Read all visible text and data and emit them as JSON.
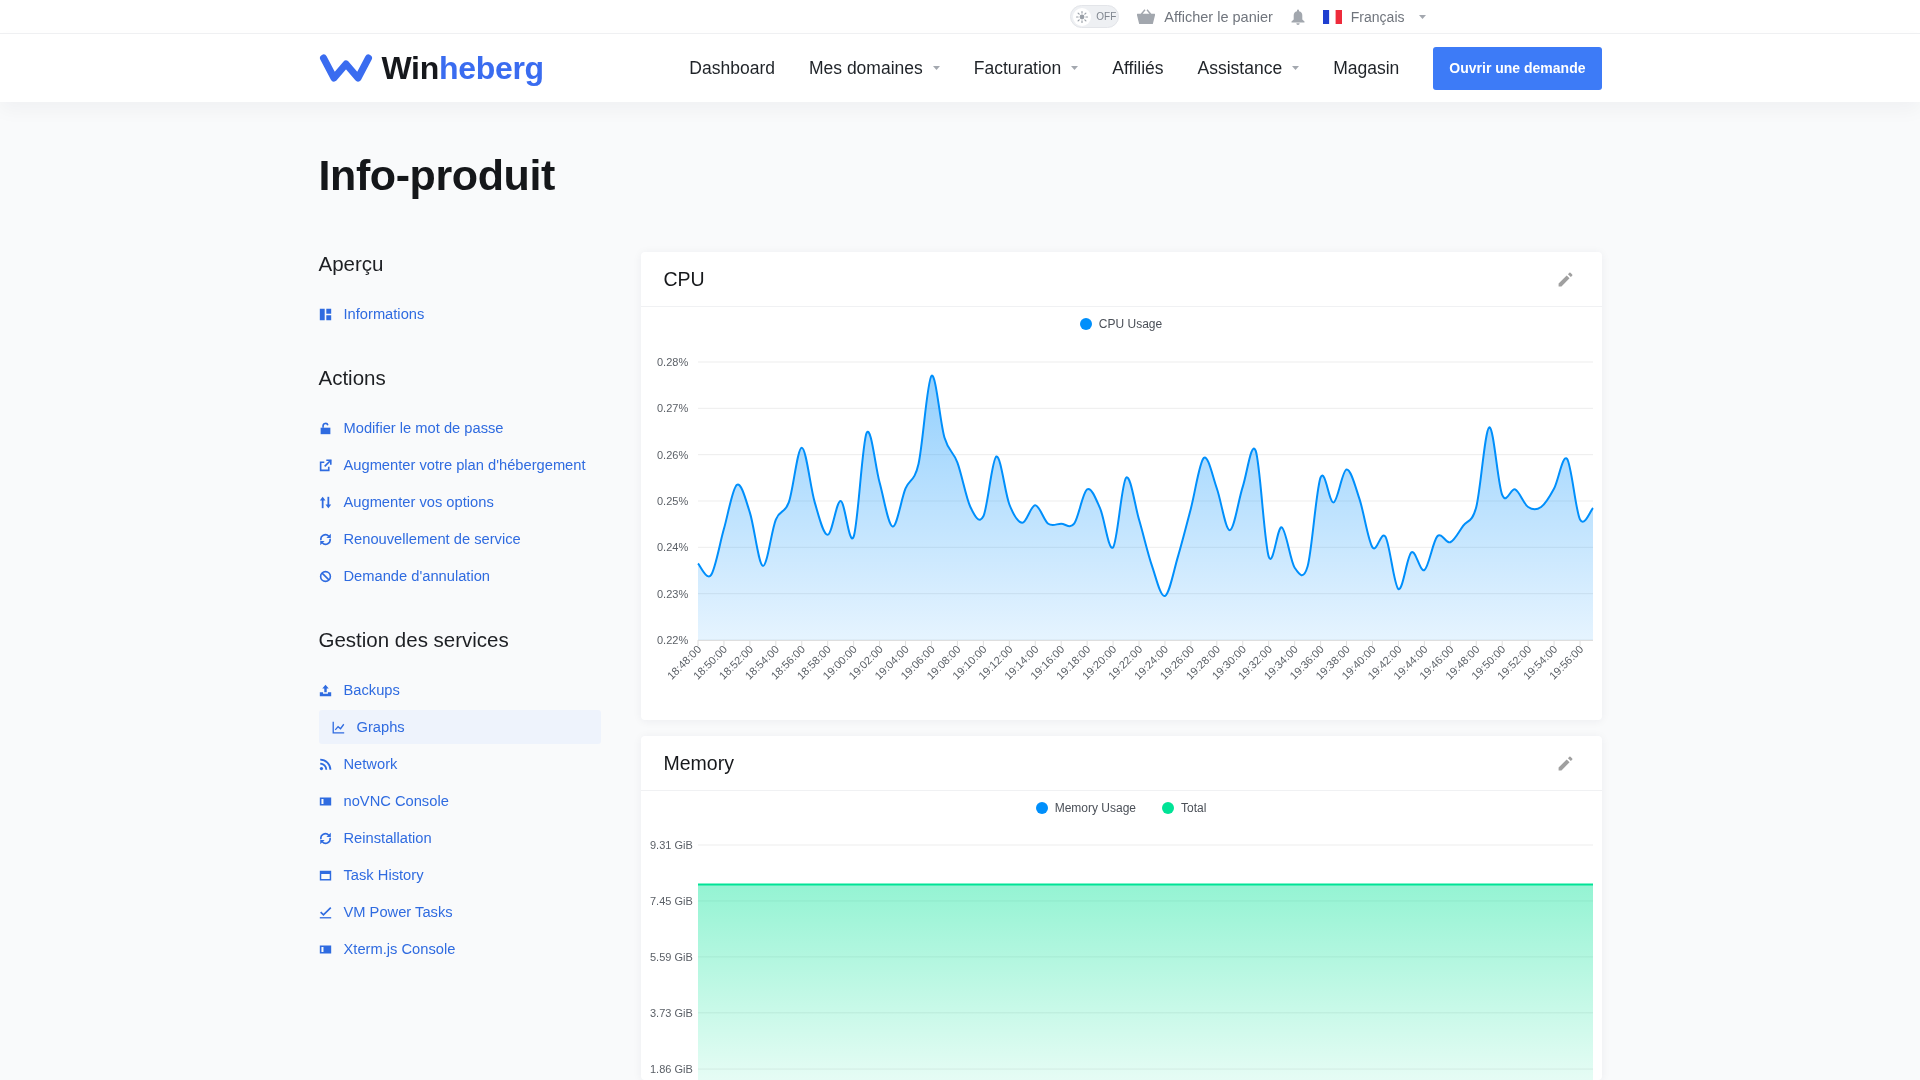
{
  "topbar": {
    "theme_toggle": {
      "label": "OFF",
      "on": false
    },
    "cart_link": "Afficher le panier",
    "language": "Français"
  },
  "navbar": {
    "brand": [
      "Win",
      "heberg"
    ],
    "links": [
      {
        "label": "Dashboard",
        "dropdown": false
      },
      {
        "label": "Mes domaines",
        "dropdown": true
      },
      {
        "label": "Facturation",
        "dropdown": true
      },
      {
        "label": "Affiliés",
        "dropdown": false
      },
      {
        "label": "Assistance",
        "dropdown": true
      },
      {
        "label": "Magasin",
        "dropdown": false
      }
    ],
    "cta": "Ouvrir une demande"
  },
  "page_title": "Info-produit",
  "sidebar": {
    "sections": [
      {
        "title": "Aperçu",
        "items": [
          {
            "label": "Informations",
            "selected": false
          }
        ]
      },
      {
        "title": "Actions",
        "items": [
          {
            "label": "Modifier le mot de passe",
            "selected": false
          },
          {
            "label": "Augmenter votre plan d'hébergement",
            "selected": false
          },
          {
            "label": "Augmenter vos options",
            "selected": false
          },
          {
            "label": "Renouvellement de service",
            "selected": false
          },
          {
            "label": "Demande d'annulation",
            "selected": false
          }
        ]
      },
      {
        "title": "Gestion des services",
        "items": [
          {
            "label": "Backups",
            "selected": false
          },
          {
            "label": "Graphs",
            "selected": true
          },
          {
            "label": "Network",
            "selected": false
          },
          {
            "label": "noVNC Console",
            "selected": false
          },
          {
            "label": "Reinstallation",
            "selected": false
          },
          {
            "label": "Task History",
            "selected": false
          },
          {
            "label": "VM Power Tasks",
            "selected": false
          },
          {
            "label": "Xterm.js Console",
            "selected": false
          }
        ]
      }
    ]
  },
  "cards": [
    {
      "title": "CPU",
      "chart_data": {
        "type": "area",
        "grid": true,
        "categories": [
          "18:48:00",
          null,
          "18:50:00",
          null,
          "18:52:00",
          null,
          "18:54:00",
          null,
          "18:56:00",
          null,
          "18:58:00",
          null,
          "19:00:00",
          null,
          "19:02:00",
          null,
          "19:04:00",
          null,
          "19:06:00",
          null,
          "19:08:00",
          null,
          "19:10:00",
          null,
          "19:12:00",
          null,
          "19:14:00",
          null,
          "19:16:00",
          null,
          "19:18:00",
          null,
          "19:20:00",
          null,
          "19:22:00",
          null,
          "19:24:00",
          null,
          "19:26:00",
          null,
          "19:28:00",
          null,
          "19:30:00",
          null,
          "19:32:00",
          null,
          "19:34:00",
          null,
          "19:36:00",
          null,
          "19:38:00",
          null,
          "19:40:00",
          null,
          "19:42:00",
          null,
          "19:44:00",
          null,
          "19:46:00",
          null,
          "19:48:00",
          null,
          "19:50:00",
          null,
          "19:52:00",
          null,
          "19:54:00",
          null,
          "19:56:00",
          null
        ],
        "ylim": [
          0.22,
          0.28
        ],
        "yticks": [
          {
            "value": 0.28,
            "label": "0.28%"
          },
          {
            "value": 0.27,
            "label": "0.27%"
          },
          {
            "value": 0.26,
            "label": "0.26%"
          },
          {
            "value": 0.25,
            "label": "0.25%"
          },
          {
            "value": 0.24,
            "label": "0.24%"
          },
          {
            "value": 0.23,
            "label": "0.23%"
          },
          {
            "value": 0.22,
            "label": "0.22%"
          }
        ],
        "series": [
          {
            "name": "CPU Usage",
            "color": "#008ffb",
            "values": [
              0.2365,
              0.234,
              0.244,
              0.2535,
              0.2475,
              0.236,
              0.246,
              0.2497,
              0.2615,
              0.2497,
              0.2427,
              0.25,
              0.2423,
              0.2647,
              0.254,
              0.2445,
              0.2527,
              0.258,
              0.277,
              0.2637,
              0.2583,
              0.2487,
              0.2467,
              0.2596,
              0.2493,
              0.2453,
              0.2491,
              0.2451,
              0.2451,
              0.2451,
              0.2525,
              0.2484,
              0.24,
              0.255,
              0.246,
              0.236,
              0.2295,
              0.238,
              0.2484,
              0.2593,
              0.2527,
              0.2437,
              0.2531,
              0.2608,
              0.238,
              0.2443,
              0.2356,
              0.2359,
              0.2551,
              0.2497,
              0.2568,
              0.2504,
              0.24,
              0.2423,
              0.231,
              0.2389,
              0.2351,
              0.2424,
              0.2411,
              0.2447,
              0.2487,
              0.2659,
              0.2513,
              0.2525,
              0.2487,
              0.2487,
              0.2527,
              0.2591,
              0.246,
              0.2485
            ]
          }
        ]
      }
    },
    {
      "title": "Memory",
      "chart_data": {
        "type": "area",
        "grid": true,
        "ylim": [
          0,
          9.31
        ],
        "yticks": [
          {
            "value": 9.31,
            "label": "9.31 GiB"
          },
          {
            "value": 7.45,
            "label": "7.45 GiB"
          },
          {
            "value": 5.59,
            "label": "5.59 GiB"
          },
          {
            "value": 3.73,
            "label": "3.73 GiB"
          },
          {
            "value": 1.86,
            "label": "1.86 GiB"
          }
        ],
        "series": [
          {
            "name": "Memory Usage",
            "color": "#008ffb"
          },
          {
            "name": "Total",
            "color": "#00e396",
            "values": [
              8,
              8,
              8,
              8,
              8,
              8,
              8,
              8,
              8,
              8,
              8,
              8,
              8,
              8,
              8,
              8,
              8,
              8,
              8,
              8,
              8,
              8,
              8,
              8,
              8,
              8,
              8,
              8,
              8,
              8,
              8,
              8,
              8,
              8,
              8,
              8,
              8,
              8,
              8,
              8,
              8,
              8,
              8,
              8,
              8,
              8,
              8,
              8,
              8,
              8,
              8,
              8,
              8,
              8,
              8,
              8,
              8,
              8,
              8,
              8,
              8,
              8,
              8,
              8,
              8,
              8,
              8,
              8,
              8,
              8
            ]
          }
        ]
      }
    }
  ]
}
